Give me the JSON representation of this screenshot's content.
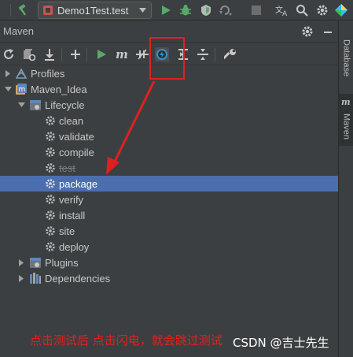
{
  "run_config": {
    "label": "Demo1Test.test"
  },
  "panel": {
    "title": "Maven"
  },
  "tree": {
    "profiles": "Profiles",
    "project": "Maven_Idea",
    "lifecycle": "Lifecycle",
    "goals": [
      "clean",
      "validate",
      "compile",
      "test",
      "package",
      "verify",
      "install",
      "site",
      "deploy"
    ],
    "plugins": "Plugins",
    "dependencies": "Dependencies"
  },
  "right_tabs": {
    "database": "Database",
    "maven": "Maven",
    "maven_letter": "m"
  },
  "annotation": {
    "caption": "点击测试后 点击闪电，就会跳过测试"
  },
  "watermark": {
    "text": "CSDN @吉士先生"
  },
  "colors": {
    "accent": "#4b6eaf",
    "annotation": "#e02020",
    "run_green": "#59a869"
  },
  "icons": [
    "hammer-icon",
    "run-icon",
    "debug-icon",
    "coverage-icon",
    "profiler-icon",
    "stop-icon",
    "translate-icon",
    "search-icon",
    "settings-icon",
    "toolbox-icon",
    "reload-icon",
    "add-icon",
    "execute-icon",
    "maven-goal-icon",
    "toggle-offline-icon",
    "skip-tests-icon",
    "show-dependencies-icon",
    "collapse-all-icon",
    "wrench-icon",
    "gear-icon"
  ]
}
